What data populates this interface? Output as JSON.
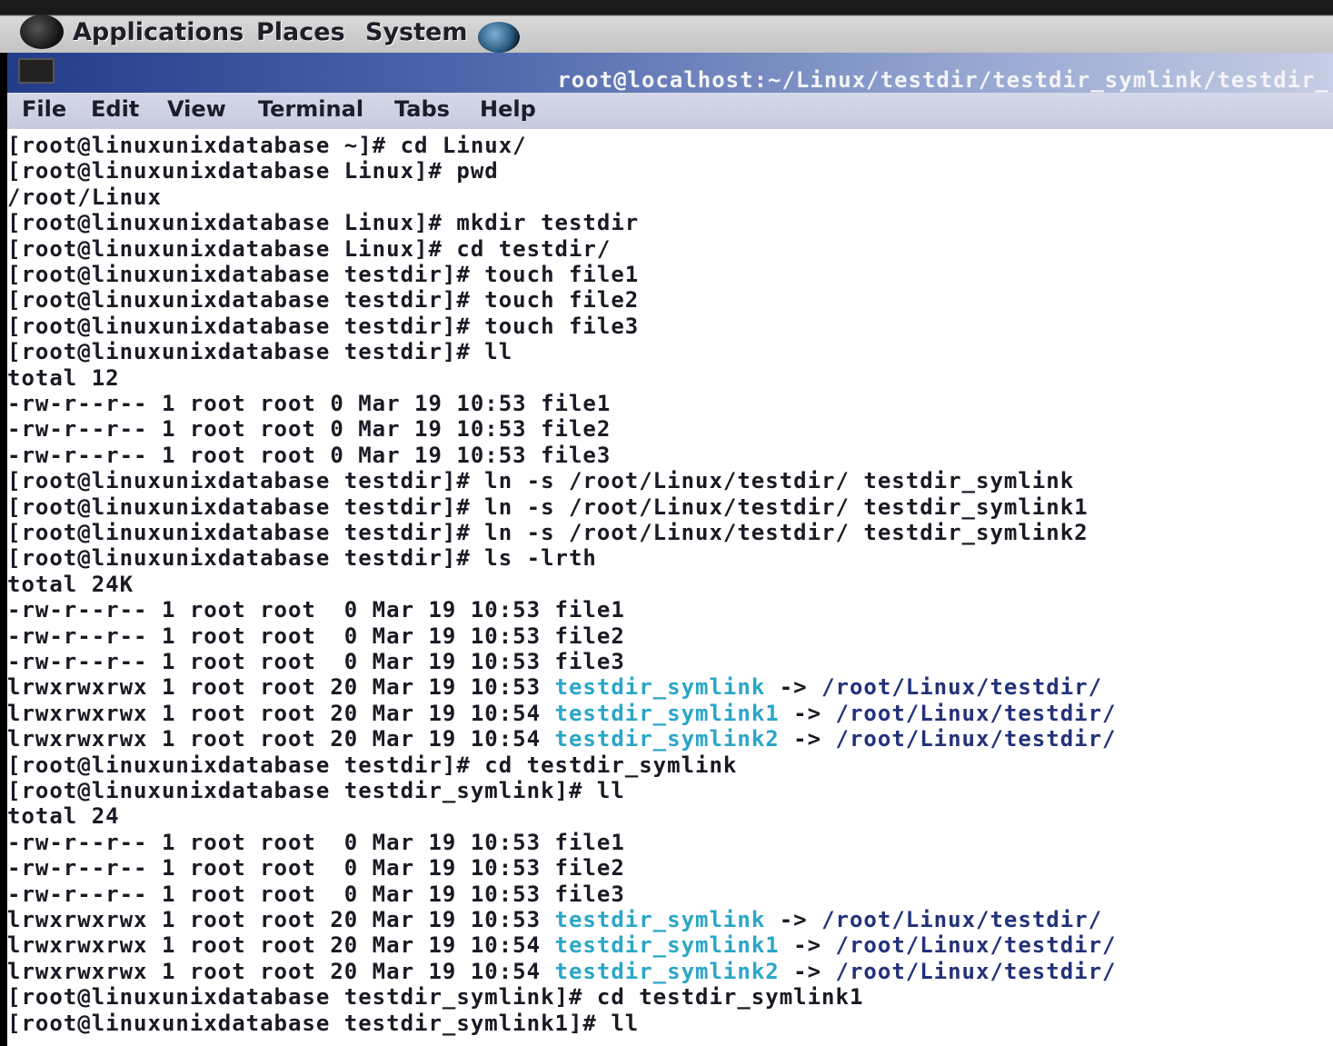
{
  "panel": {
    "applications": "Applications",
    "places": "Places",
    "system": "System"
  },
  "window": {
    "title": "root@localhost:~/Linux/testdir/testdir_symlink/testdir_"
  },
  "menu": [
    "File",
    "Edit",
    "View",
    "Terminal",
    "Tabs",
    "Help"
  ],
  "terminal": {
    "lines": [
      "[root@linuxunixdatabase ~]# cd Linux/",
      "[root@linuxunixdatabase Linux]# pwd",
      "/root/Linux",
      "[root@linuxunixdatabase Linux]# mkdir testdir",
      "[root@linuxunixdatabase Linux]# cd testdir/",
      "[root@linuxunixdatabase testdir]# touch file1",
      "[root@linuxunixdatabase testdir]# touch file2",
      "[root@linuxunixdatabase testdir]# touch file3",
      "[root@linuxunixdatabase testdir]# ll",
      "total 12",
      "-rw-r--r-- 1 root root 0 Mar 19 10:53 file1",
      "-rw-r--r-- 1 root root 0 Mar 19 10:53 file2",
      "-rw-r--r-- 1 root root 0 Mar 19 10:53 file3",
      "[root@linuxunixdatabase testdir]# ln -s /root/Linux/testdir/ testdir_symlink",
      "[root@linuxunixdatabase testdir]# ln -s /root/Linux/testdir/ testdir_symlink1",
      "[root@linuxunixdatabase testdir]# ln -s /root/Linux/testdir/ testdir_symlink2",
      "[root@linuxunixdatabase testdir]# ls -lrth",
      "total 24K",
      "-rw-r--r-- 1 root root  0 Mar 19 10:53 file1",
      "-rw-r--r-- 1 root root  0 Mar 19 10:53 file2",
      "-rw-r--r-- 1 root root  0 Mar 19 10:53 file3",
      {
        "pre": "lrwxrwxrwx 1 root root 20 Mar 19 10:53 ",
        "link": "testdir_symlink",
        "arrow": " -> ",
        "target": "/root/Linux/testdir/"
      },
      {
        "pre": "lrwxrwxrwx 1 root root 20 Mar 19 10:54 ",
        "link": "testdir_symlink1",
        "arrow": " -> ",
        "target": "/root/Linux/testdir/"
      },
      {
        "pre": "lrwxrwxrwx 1 root root 20 Mar 19 10:54 ",
        "link": "testdir_symlink2",
        "arrow": " -> ",
        "target": "/root/Linux/testdir/"
      },
      "[root@linuxunixdatabase testdir]# cd testdir_symlink",
      "[root@linuxunixdatabase testdir_symlink]# ll",
      "total 24",
      "-rw-r--r-- 1 root root  0 Mar 19 10:53 file1",
      "-rw-r--r-- 1 root root  0 Mar 19 10:53 file2",
      "-rw-r--r-- 1 root root  0 Mar 19 10:53 file3",
      {
        "pre": "lrwxrwxrwx 1 root root 20 Mar 19 10:53 ",
        "link": "testdir_symlink",
        "arrow": " -> ",
        "target": "/root/Linux/testdir/"
      },
      {
        "pre": "lrwxrwxrwx 1 root root 20 Mar 19 10:54 ",
        "link": "testdir_symlink1",
        "arrow": " -> ",
        "target": "/root/Linux/testdir/"
      },
      {
        "pre": "lrwxrwxrwx 1 root root 20 Mar 19 10:54 ",
        "link": "testdir_symlink2",
        "arrow": " -> ",
        "target": "/root/Linux/testdir/"
      },
      "[root@linuxunixdatabase testdir_symlink]# cd testdir_symlink1",
      "[root@linuxunixdatabase testdir_symlink1]# ll"
    ]
  }
}
